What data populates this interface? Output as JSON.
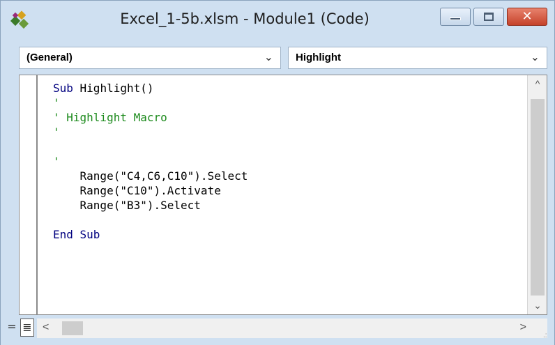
{
  "window": {
    "title": "Excel_1-5b.xlsm - Module1 (Code)",
    "icon": "vba-module-icon",
    "buttons": {
      "minimize_icon": "minimize-icon",
      "maximize_icon": "maximize-icon",
      "close_label": "✕"
    },
    "colors": {
      "frame": "#cfe0f1",
      "close": "#c5422a",
      "keyword": "#00007f",
      "comment": "#1c8a1c"
    }
  },
  "dropdowns": {
    "object": {
      "value": "(General)",
      "arrow": "⌄"
    },
    "procedure": {
      "value": "Highlight",
      "arrow": "⌄"
    }
  },
  "code": {
    "lines": [
      {
        "parts": [
          {
            "t": "kw",
            "v": "Sub"
          },
          {
            "t": "tx",
            "v": " Highlight()"
          }
        ]
      },
      {
        "parts": [
          {
            "t": "cm",
            "v": "'"
          }
        ]
      },
      {
        "parts": [
          {
            "t": "cm",
            "v": "' Highlight Macro"
          }
        ]
      },
      {
        "parts": [
          {
            "t": "cm",
            "v": "'"
          }
        ]
      },
      {
        "parts": [
          {
            "t": "tx",
            "v": ""
          }
        ]
      },
      {
        "parts": [
          {
            "t": "cm",
            "v": "'"
          }
        ]
      },
      {
        "parts": [
          {
            "t": "tx",
            "v": "    Range(\"C4,C6,C10\").Select"
          }
        ]
      },
      {
        "parts": [
          {
            "t": "tx",
            "v": "    Range(\"C10\").Activate"
          }
        ]
      },
      {
        "parts": [
          {
            "t": "tx",
            "v": "    Range(\"B3\").Select"
          }
        ]
      },
      {
        "parts": [
          {
            "t": "tx",
            "v": ""
          }
        ]
      },
      {
        "parts": [
          {
            "t": "kw",
            "v": "End Sub"
          }
        ]
      }
    ]
  },
  "scrollbars": {
    "up_arrow": "^",
    "down_arrow": "⌄",
    "left_arrow": "<",
    "right_arrow": ">"
  },
  "view_buttons": {
    "procedure_view": "=",
    "full_module_view": "≣"
  }
}
